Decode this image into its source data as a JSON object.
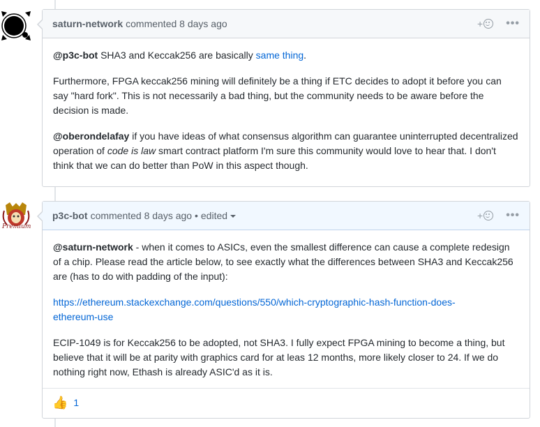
{
  "comment1": {
    "author": "saturn-network",
    "meta": "commented 8 days ago",
    "reaction_add": "+",
    "more": "•••",
    "p1_mention": "@p3c-bot",
    "p1_text": " SHA3 and Keccak256 are basically ",
    "p1_link": "same thing",
    "p1_end": ".",
    "p2": "Furthermore, FPGA keccak256 mining will definitely be a thing if ETC decides to adopt it before you can say \"hard fork\". This is not necessarily a bad thing, but the community needs to be aware before the decision is made.",
    "p3_mention": "@oberondelafay",
    "p3_text1": " if you have ideas of what consensus algorithm can guarantee uninterrupted decentralized operation of ",
    "p3_italic": "code is law",
    "p3_text2": " smart contract platform I'm sure this community would love to hear that. I don't think that we can do better than PoW in this aspect though."
  },
  "comment2": {
    "author": "p3c-bot",
    "meta": "commented 8 days ago •",
    "edited": "edited",
    "reaction_add": "+",
    "more": "•••",
    "p1_mention": "@saturn-network",
    "p1_text": " - when it comes to ASICs, even the smallest difference can cause a complete redesign of a chip. Please read the article below, to see exactly what the differences between SHA3 and Keccak256 are (has to do with padding of the input):",
    "link": "https://ethereum.stackexchange.com/questions/550/which-cryptographic-hash-function-does-ethereum-use",
    "p3": "ECIP-1049 is for Keccak256 to be adopted, not SHA3. I fully expect FPGA mining to become a thing, but believe that it will be at parity with graphics card for at leas 12 months, more likely closer to 24. If we do nothing right now, Ethash is already ASIC'd as it is.",
    "reaction_emoji": "👍",
    "reaction_count": "1"
  },
  "avatar2_caption": "Premium"
}
